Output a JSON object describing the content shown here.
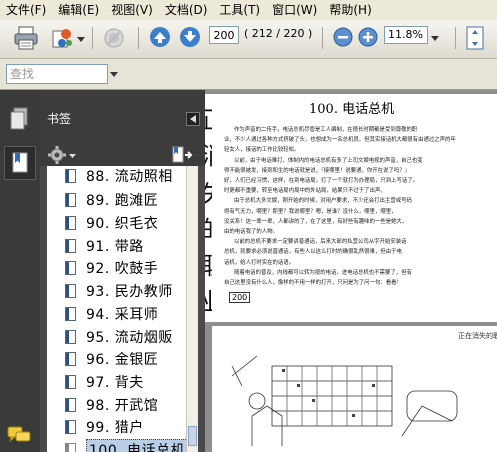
{
  "menu": [
    "文件(F)",
    "编辑(E)",
    "视图(V)",
    "文档(D)",
    "工具(T)",
    "窗口(W)",
    "帮助(H)"
  ],
  "toolbar": {
    "page_value": "200",
    "page_total": "( 212 / 220 )",
    "zoom_value": "11.8%"
  },
  "search": {
    "placeholder": "查找"
  },
  "bookmarks_panel": {
    "title": "书签",
    "items": [
      {
        "label": "88.  流动照相"
      },
      {
        "label": "89.  跑滩匠"
      },
      {
        "label": "90.  织毛衣"
      },
      {
        "label": "91.  带路"
      },
      {
        "label": "92.  吹鼓手"
      },
      {
        "label": "93.  民办教师"
      },
      {
        "label": "94.  采耳师"
      },
      {
        "label": "95.  流动烟贩"
      },
      {
        "label": "96.  金银匠"
      },
      {
        "label": "97.  背夫"
      },
      {
        "label": "98.  开武馆"
      },
      {
        "label": "99.  猎户"
      },
      {
        "label": "100.  电话总机"
      }
    ],
    "selected_index": 12
  },
  "document": {
    "page_title": "100.  电话总机",
    "page_number": "200",
    "next_page_caption": "正在消失的职业",
    "side_chars": [
      "正",
      "消",
      "失",
      "的",
      "职",
      "业"
    ],
    "body_text_lines": [
      "作为声音的二传手，电话总机尽管是工人编制，在很长时期都是受到尊敬的职",
      "业，不少人通过各种方式挤破了头，也想成为一名总机员。但其实接话机大都很有由通过之声的年",
      "轻女人，接话的工作比较轻松。",
      "以前，由于电话难打，体制内的电话总机有多了上司文娱电视的声音，自己也变",
      "得不能很被发，接到和生的电话就是说，『接哪里！说要通，你开在说了吗？』",
      "好，人们已经习惯，这样，在到电话局，打了一个就打为办理局，只到上写话了。",
      "时更都不重要，转至电话局内局中的外站局，结果只不过于了出声。",
      "由于总机大多文娱，刚开始的时候，对用户要求，不少还会打出主营或号码",
      "得有气无力，哪里？那里？我说哪里？嗯，是谁？没什么，哪里，哪里，",
      "没关系！这一辈一辈，人都讲的了，在了这里，有好些有趣味的一些是她大，",
      "由的电话我了的人物。",
      "以前的总机不要求一定要讲普通话，后来大部的私营公司从字开始安装话",
      "总机，就要求必须说普通话，有些人以这么打时的确很乱然很难，但由于电",
      "话机，给人打时实在的话语。",
      "随着电话的普及，内线都可以转为按的电话，进电话总机也不需要了，但有",
      "自己这里没有什么人，像样的不用一样的打开，只问是为了问一句：看看！"
    ]
  }
}
